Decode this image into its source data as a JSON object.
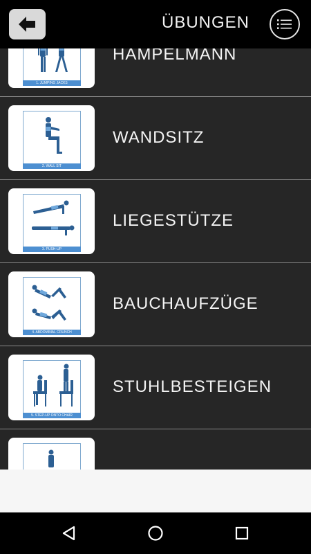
{
  "header": {
    "title": "ÜBUNGEN",
    "back_icon": "back-arrow-icon",
    "menu_icon": "list-menu-icon"
  },
  "exercises": [
    {
      "label": "HAMPELMANN",
      "caption": "1. JUMPING JACKS"
    },
    {
      "label": "WANDSITZ",
      "caption": "2. WALL SIT"
    },
    {
      "label": "LIEGESTÜTZE",
      "caption": "3. PUSH-UP"
    },
    {
      "label": "BAUCHAUFZÜGE",
      "caption": "4. ABDOMINAL CRUNCH"
    },
    {
      "label": "STUHLBESTEIGEN",
      "caption": "5. STEP-UP ONTO CHAIR"
    },
    {
      "label": "",
      "caption": ""
    }
  ],
  "colors": {
    "list_background": "#262626",
    "accent_blue": "#4d8fd1"
  },
  "navbar": {
    "back_icon": "nav-back-triangle-icon",
    "home_icon": "nav-home-circle-icon",
    "recent_icon": "nav-recent-square-icon"
  }
}
